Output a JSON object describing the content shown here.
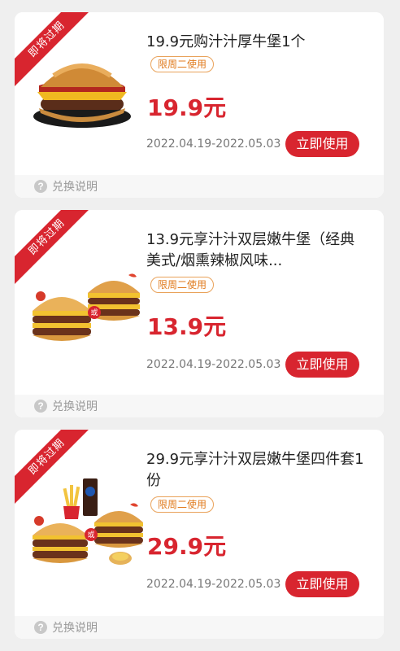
{
  "coupons": [
    {
      "ribbon": "即将过期",
      "title": "19.9元购汁汁厚牛堡1个",
      "badge": "限周二使用",
      "price": "19.9元",
      "dates": "2022.04.19-2022.05.03",
      "button": "立即使用",
      "footer": "兑换说明",
      "image": "burger-single-image"
    },
    {
      "ribbon": "即将过期",
      "title": "13.9元享汁汁双层嫩牛堡（经典美式/烟熏辣椒风味...",
      "badge": "限周二使用",
      "price": "13.9元",
      "dates": "2022.04.19-2022.05.03",
      "button": "立即使用",
      "footer": "兑换说明",
      "or_label": "或",
      "image": "double-burger-pair-image"
    },
    {
      "ribbon": "即将过期",
      "title": "29.9元享汁汁双层嫩牛堡四件套1份",
      "badge": "限周二使用",
      "price": "29.9元",
      "dates": "2022.04.19-2022.05.03",
      "button": "立即使用",
      "footer": "兑换说明",
      "or_label": "或",
      "image": "burger-combo-image"
    }
  ],
  "help_icon": "?",
  "colors": {
    "accent": "#d8252f",
    "badge": "#e07a1c",
    "background": "#efefef"
  }
}
